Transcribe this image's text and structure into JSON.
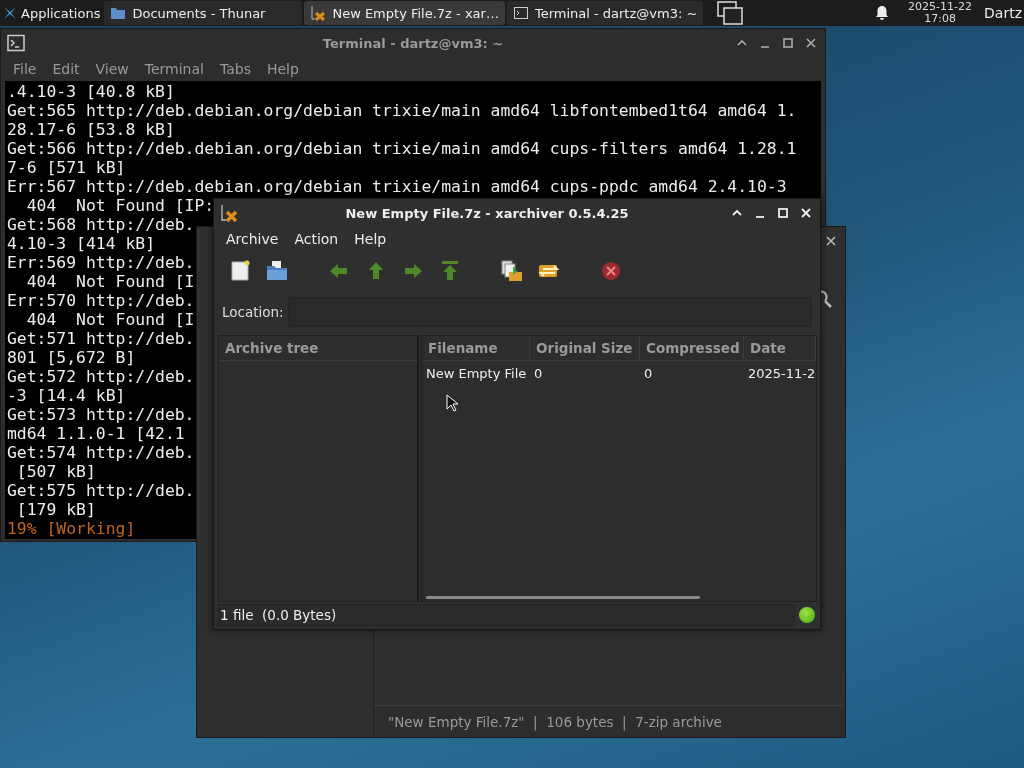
{
  "taskbar": {
    "apps_button": "Applications",
    "tasks": [
      {
        "label": "Documents - Thunar",
        "selected": false,
        "kind": "folder"
      },
      {
        "label": "New Empty File.7z - xar…",
        "selected": true,
        "kind": "archive"
      },
      {
        "label": "Terminal - dartz@vm3: ~",
        "selected": false,
        "kind": "terminal"
      }
    ],
    "date": "2025-11-22",
    "time": "17:08",
    "user": "Dartz"
  },
  "terminal": {
    "title": "Terminal - dartz@vm3: ~",
    "menu": [
      "File",
      "Edit",
      "View",
      "Terminal",
      "Tabs",
      "Help"
    ],
    "lines": [
      ".4.10-3 [40.8 kB]",
      "Get:565 http://deb.debian.org/debian trixie/main amd64 libfontembed1t64 amd64 1.",
      "28.17-6 [53.8 kB]",
      "Get:566 http://deb.debian.org/debian trixie/main amd64 cups-filters amd64 1.28.1",
      "7-6 [571 kB]",
      "Err:567 http://deb.debian.org/debian trixie/main amd64 cups-ppdc amd64 2.4.10-3",
      "  404  Not Found [IP:",
      "Get:568 http://deb.",
      "4.10-3 [414 kB]",
      "Err:569 http://deb.",
      "  404  Not Found [I",
      "Err:570 http://deb.",
      "  404  Not Found [I",
      "Get:571 http://deb.",
      "801 [5,672 B]",
      "Get:572 http://deb.",
      "-3 [14.4 kB]",
      "Get:573 http://deb.",
      "md64 1.1.0-1 [42.1",
      "Get:574 http://deb.",
      " [507 kB]",
      "Get:575 http://deb.",
      " [179 kB]"
    ],
    "progress": "19% [Working]"
  },
  "thunar": {
    "status": "\"New Empty File.7z\"  |  106 bytes  |  7-zip archive"
  },
  "xarchiver": {
    "title": "New Empty File.7z - xarchiver 0.5.4.25",
    "menu": [
      "Archive",
      "Action",
      "Help"
    ],
    "location_label": "Location:",
    "tree_header": "Archive tree",
    "columns": [
      "Filename",
      "Original Size",
      "Compressed",
      "Date"
    ],
    "rows": [
      {
        "cells": [
          "New Empty File",
          "0",
          "0",
          "2025-11-2"
        ]
      }
    ],
    "status": "1 file  (0.0 Bytes)"
  }
}
